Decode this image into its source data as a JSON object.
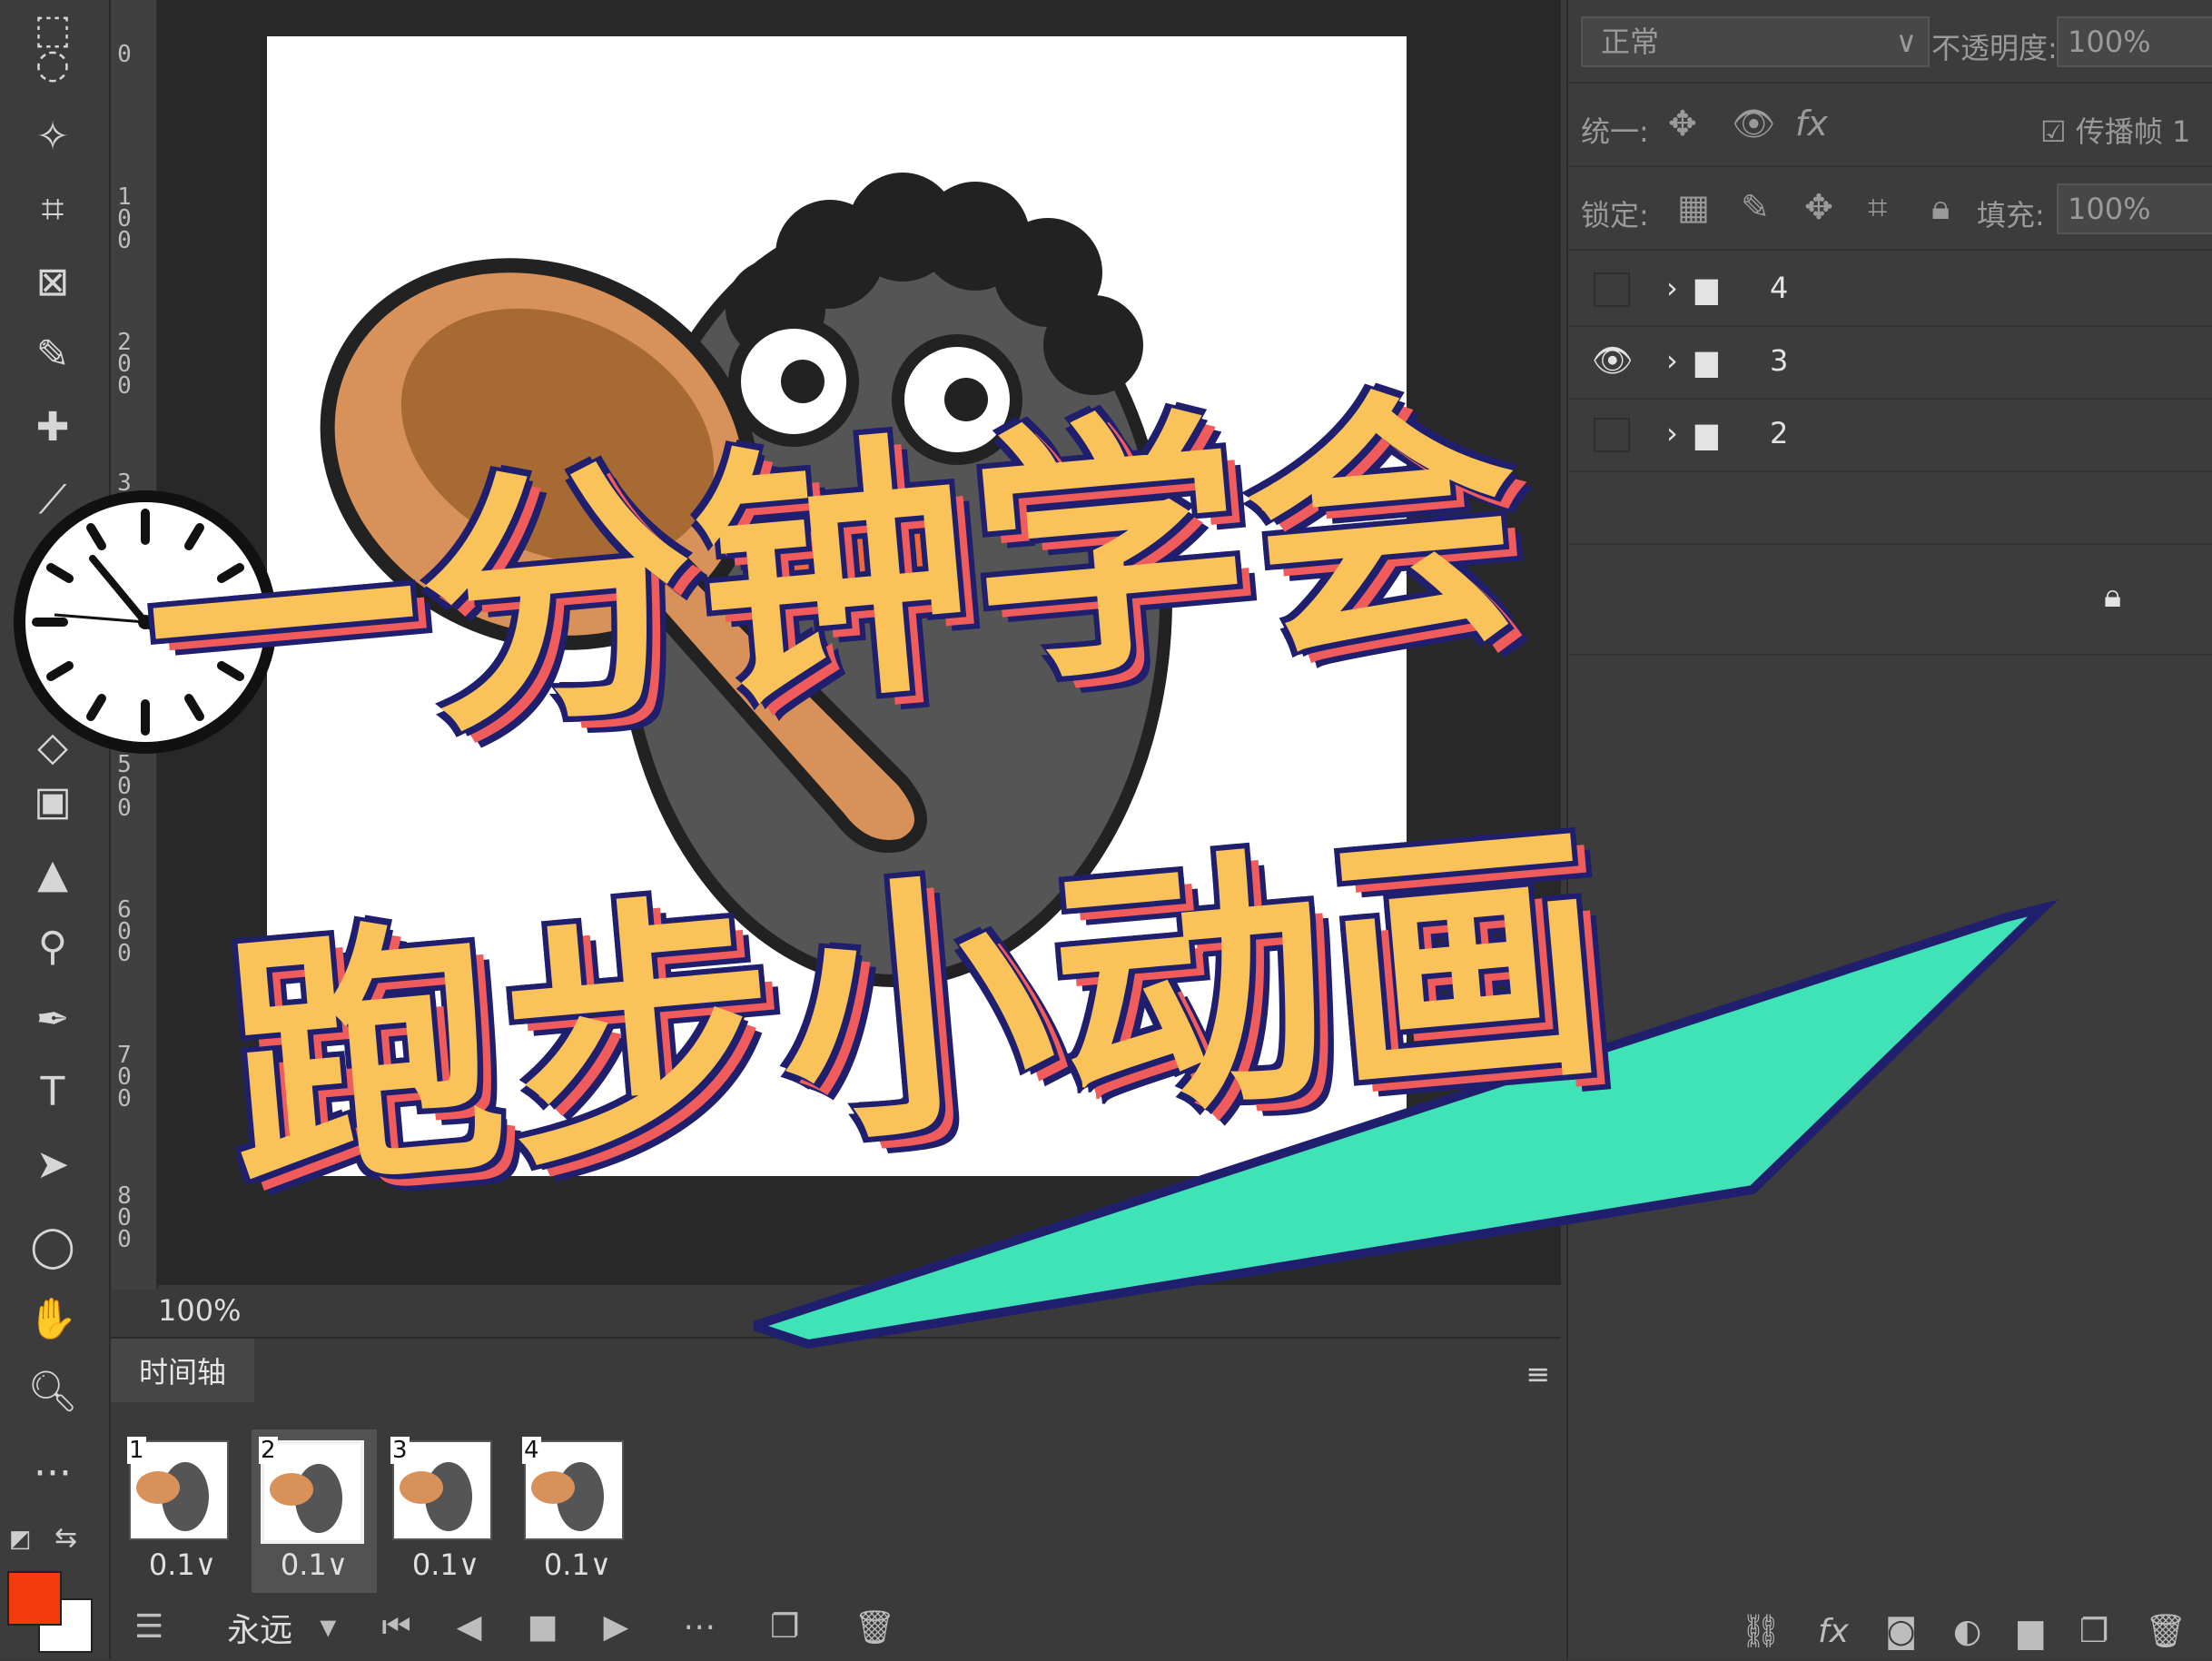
{
  "colors": {
    "accent_foreground": "#f43b0d",
    "background_swatch": "#ffffff",
    "title_fill": "#f9c35a",
    "title_shadow": "#f05b5b",
    "title_outline": "#1f1f6e",
    "teal_banner": "#40e3b5"
  },
  "toolbar": {
    "tools": [
      "lasso-icon",
      "magic-wand-icon",
      "crop-icon",
      "frame-icon",
      "eyedropper-icon",
      "healing-icon",
      "brush-icon",
      "eraser-icon",
      "gradient-icon",
      "blur-icon",
      "dodge-icon",
      "pen-icon",
      "type-icon",
      "path-select-icon",
      "ellipse-icon",
      "hand-icon",
      "zoom-icon",
      "more-icon"
    ]
  },
  "ruler": {
    "labels": [
      "0",
      "1\n0\n0",
      "2\n0\n0",
      "3",
      "5\n0\n0",
      "6\n0\n0",
      "7\n0\n0",
      "8\n0\n0"
    ]
  },
  "status": {
    "zoom": "100%"
  },
  "timeline": {
    "tab_label": "时间轴",
    "frames": [
      {
        "num": "1",
        "delay": "0.1∨"
      },
      {
        "num": "2",
        "delay": "0.1∨"
      },
      {
        "num": "3",
        "delay": "0.1∨"
      },
      {
        "num": "4",
        "delay": "0.1∨"
      }
    ],
    "loop_label": "永远"
  },
  "panel": {
    "blend_mode": "正常",
    "opacity_label": "不透明度:",
    "opacity_value": "100%",
    "unify_label": "统一:",
    "propagate_label": "传播帧 1",
    "lock_label": "锁定:",
    "fill_label": "填充:",
    "fill_value": "100%",
    "layers": [
      {
        "name": "4",
        "visible": false
      },
      {
        "name": "3",
        "visible": true
      },
      {
        "name": "2",
        "visible": false
      }
    ]
  },
  "overlay": {
    "line1": "一分钟学会",
    "line2": "跑步小动画"
  }
}
